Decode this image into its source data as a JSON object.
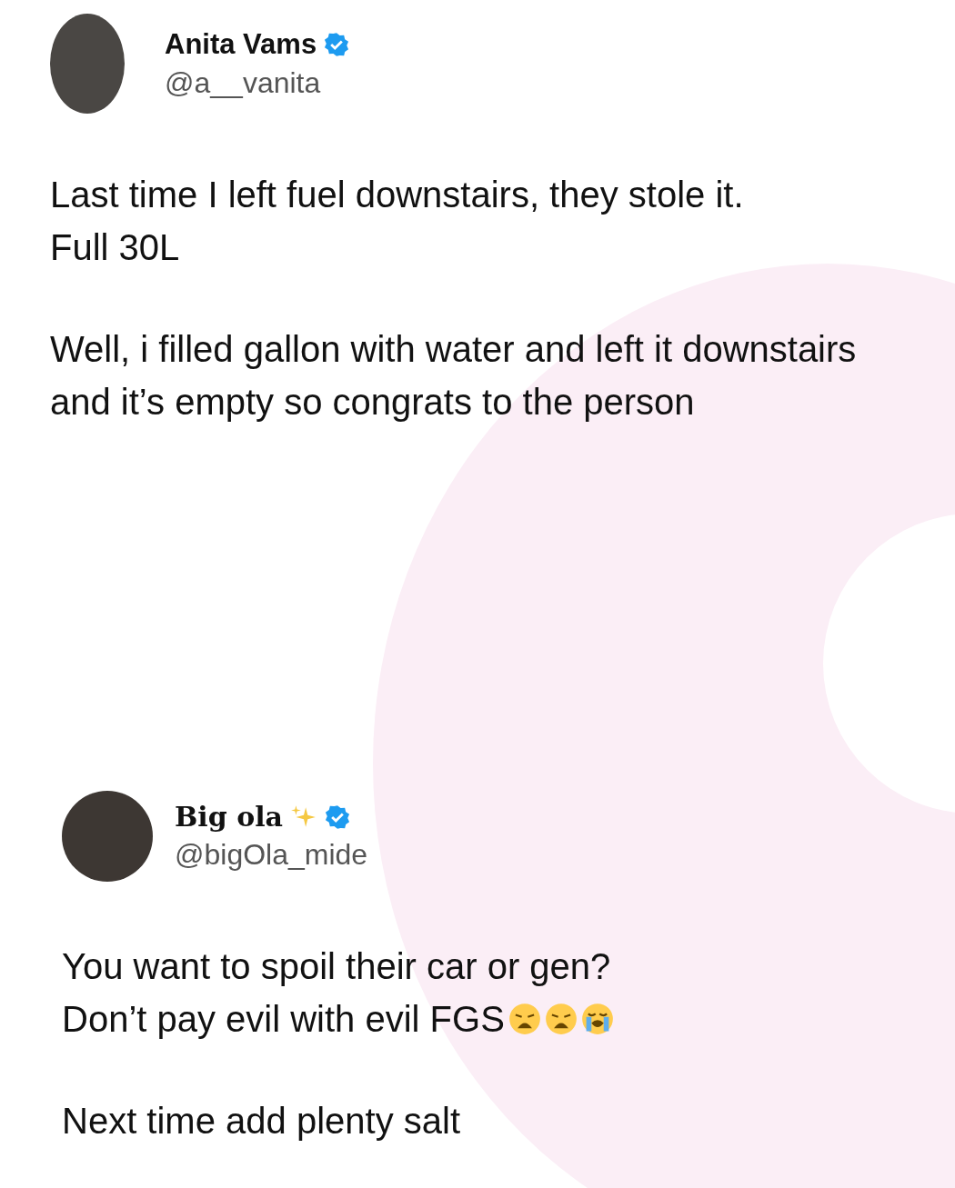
{
  "posts": [
    {
      "name": "Anita Vams",
      "verified": true,
      "sparkles": false,
      "handle": "@a__vanita",
      "paragraphs": [
        {
          "lines": [
            "Last time I left fuel downstairs, they stole it.",
            "Full 30L"
          ]
        },
        {
          "lines": [
            "Well, i filled gallon with water and left it downstairs and it’s empty so congrats to the person"
          ]
        }
      ]
    },
    {
      "name": "Big ola",
      "verified": true,
      "sparkles": true,
      "handle": "@bigOla_mide",
      "paragraphs": [
        {
          "lines": [
            "You want to spoil their car or gen?",
            "Don’t pay evil with evil FGS"
          ],
          "emojis": [
            {
              "kind": "weary"
            },
            {
              "kind": "weary"
            },
            {
              "kind": "crying"
            }
          ]
        },
        {
          "lines": [
            "Next time add plenty salt"
          ]
        }
      ]
    }
  ]
}
